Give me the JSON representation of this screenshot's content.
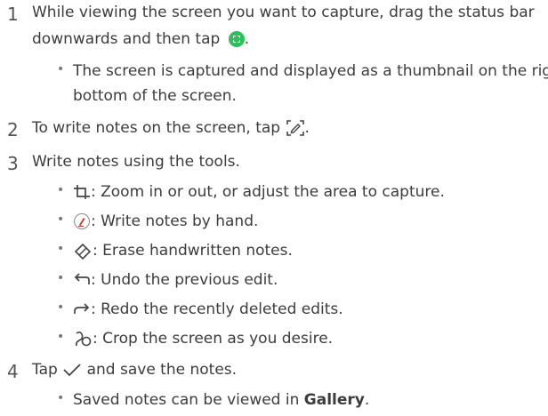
{
  "steps": [
    {
      "number": "1",
      "text_line1": "While viewing the screen you want to capture, drag the status bar",
      "text_line2_before_icon": "downwards and then tap",
      "text_line2_after_icon": ".",
      "icon": "capture-icon",
      "bullet_line1": "The screen is captured and displayed as a thumbnail on the right",
      "bullet_line2": "bottom of the screen."
    },
    {
      "number": "2",
      "text_before_icon": "To write notes on the screen, tap",
      "text_after_icon": ".",
      "icon": "write-icon"
    },
    {
      "number": "3",
      "text": "Write notes using the tools.",
      "tools": [
        {
          "icon": "crop-icon",
          "text": ": Zoom in or out, or adjust the area to capture."
        },
        {
          "icon": "pen-icon",
          "text": ": Write notes by hand."
        },
        {
          "icon": "eraser-icon",
          "text": ": Erase handwritten notes."
        },
        {
          "icon": "undo-icon",
          "text": ": Undo the previous edit."
        },
        {
          "icon": "redo-icon",
          "text": ": Redo the recently deleted edits."
        },
        {
          "icon": "lasso-icon",
          "text": ": Crop the screen as you desire."
        }
      ]
    },
    {
      "number": "4",
      "text_before_icon": "Tap",
      "text_after_icon": "and save the notes.",
      "icon": "checkmark-icon",
      "bullet_before": "Saved notes can be viewed in",
      "bullet_bold": "Gallery",
      "bullet_after": "."
    }
  ],
  "bullet_glyph": "•",
  "colors": {
    "text": "#3c3c3c",
    "capture_icon": "#2fbf5a",
    "pen_icon_accent": "#c0392b"
  }
}
